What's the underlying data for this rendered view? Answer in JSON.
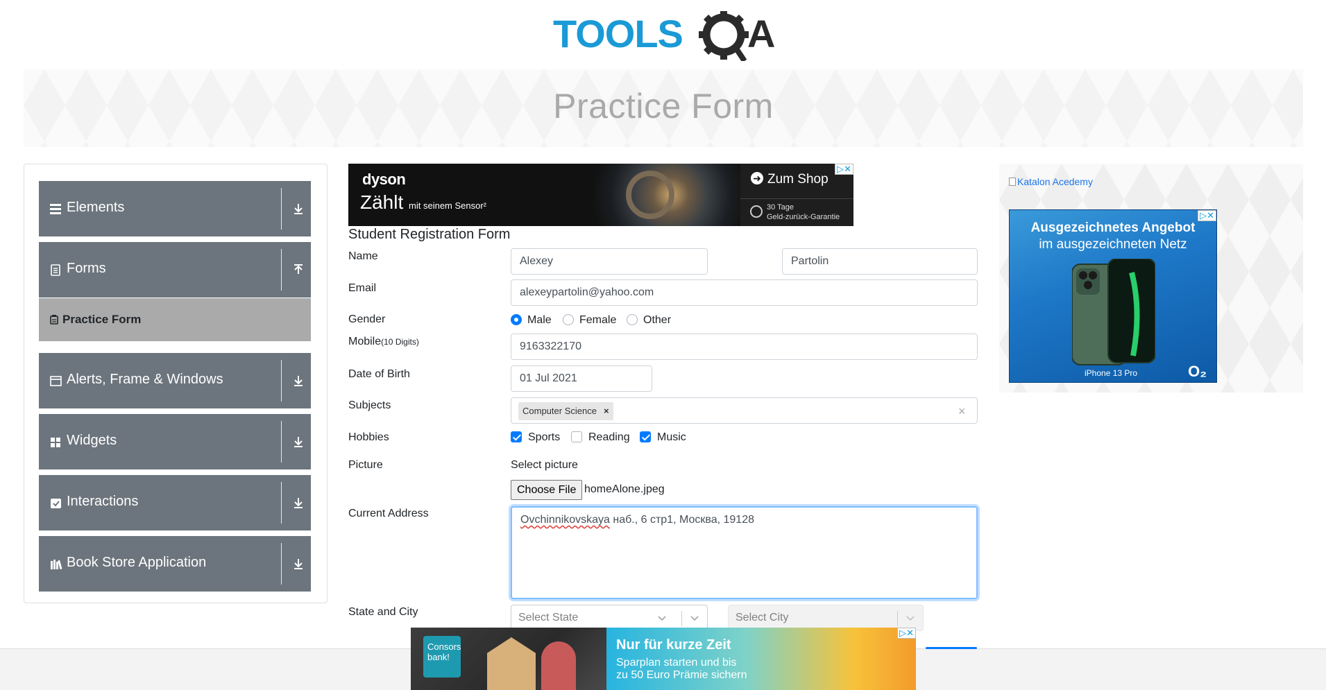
{
  "header": {
    "logo_alt": "TOOLSQA",
    "page_title": "Practice Form"
  },
  "sidebar": {
    "groups": [
      {
        "label": "Elements",
        "icon": "menu-icon",
        "arrow": "download-icon"
      },
      {
        "label": "Forms",
        "icon": "document-icon",
        "arrow": "upload-icon"
      },
      {
        "label": "Alerts, Frame & Windows",
        "icon": "window-icon",
        "arrow": "download-icon"
      },
      {
        "label": "Widgets",
        "icon": "grid-icon",
        "arrow": "download-icon"
      },
      {
        "label": "Interactions",
        "icon": "interaction-icon",
        "arrow": "download-icon"
      },
      {
        "label": "Book Store Application",
        "icon": "books-icon",
        "arrow": "download-icon"
      }
    ],
    "active_item": {
      "label": "Practice Form",
      "icon": "clipboard-icon"
    }
  },
  "ad_top": {
    "brand": "dyson",
    "tagline": "Zählt",
    "tagline_small": "mit seinem Sensor²",
    "cta": "Zum Shop",
    "guarantee_line1": "30 Tage",
    "guarantee_line2": "Geld-zurück-Garantie",
    "adchoice": "▷✕"
  },
  "form": {
    "title": "Student Registration Form",
    "labels": {
      "name": "Name",
      "email": "Email",
      "gender": "Gender",
      "mobile": "Mobile",
      "mobile_hint": "(10 Digits)",
      "dob": "Date of Birth",
      "subjects": "Subjects",
      "hobbies": "Hobbies",
      "picture": "Picture",
      "address": "Current Address",
      "state_city": "State and City"
    },
    "first_name": "Alexey",
    "last_name": "Partolin",
    "email": "alexeypartolin@yahoo.com",
    "gender_options": [
      {
        "label": "Male",
        "checked": true
      },
      {
        "label": "Female",
        "checked": false
      },
      {
        "label": "Other",
        "checked": false
      }
    ],
    "mobile": "9163322170",
    "dob": "01 Jul 2021",
    "subjects": [
      "Computer Science"
    ],
    "subject_remove": "×",
    "subjects_clear": "×",
    "hobbies": [
      {
        "label": "Sports",
        "checked": true
      },
      {
        "label": "Reading",
        "checked": false
      },
      {
        "label": "Music",
        "checked": true
      }
    ],
    "picture_caption": "Select picture",
    "file_button": "Choose File",
    "file_name": "homeAlone.jpeg",
    "address_misspelled": "Ovchinnikovskaya",
    "address_rest": " наб., 6 стр1, Москва, 19128",
    "state_placeholder": "Select State",
    "city_placeholder": "Select City"
  },
  "right_ad": {
    "katalon_alt": "Katalon Acedemy",
    "headline_line1": "Ausgezeichnetes Angebot",
    "headline_line2": "im ausgezeichneten Netz",
    "model": "iPhone 13 Pro",
    "brand": "O₂",
    "adchoice": "▷✕"
  },
  "ad_bottom": {
    "brand": "Consors bank!",
    "headline": "Nur für kurze Zeit",
    "sub_line1": "Sparplan starten und bis",
    "sub_line2": "zu 50 Euro Prämie sichern",
    "adchoice": "▷✕"
  },
  "colors": {
    "primary": "#007bff",
    "sidebar_group": "#6c757d",
    "active_item": "#aaaaaa",
    "logo_blue": "#1a9ad6",
    "logo_dark": "#2b2b2b"
  }
}
